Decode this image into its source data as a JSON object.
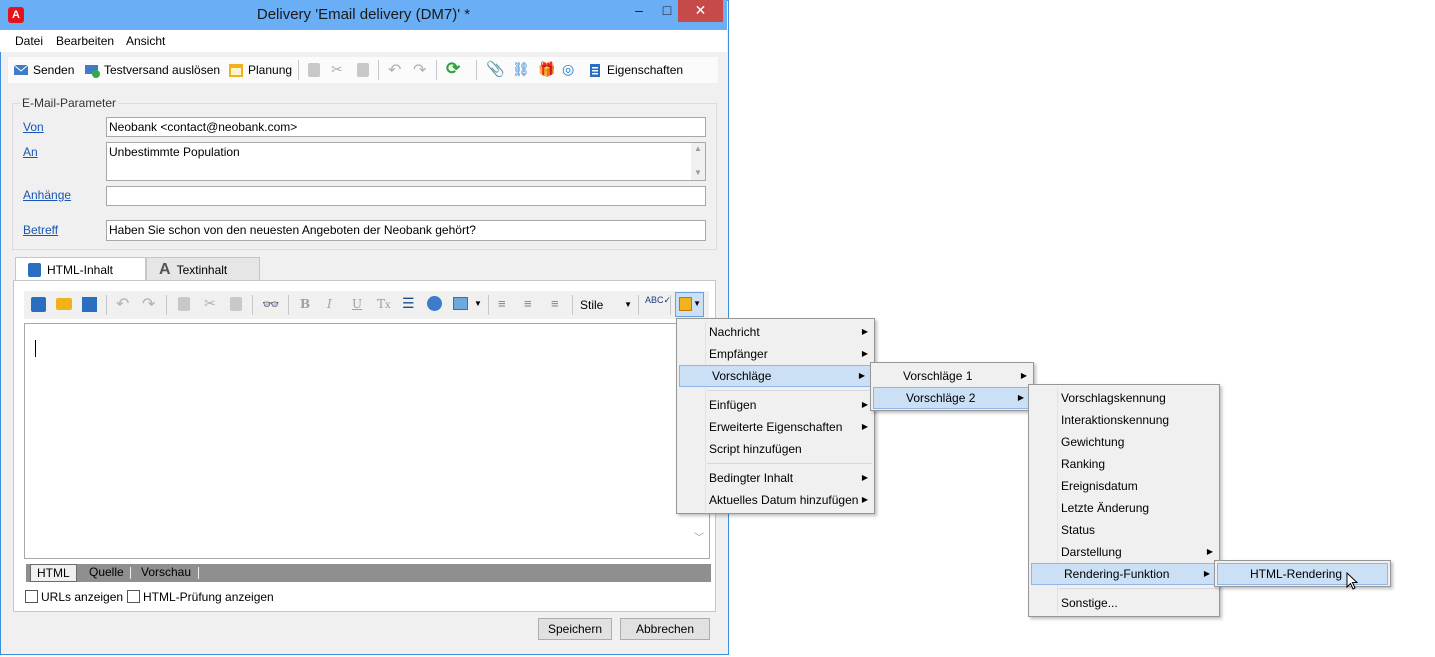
{
  "window": {
    "title": "Delivery 'Email delivery (DM7)' *",
    "app_icon": "Adobe-icon",
    "minimize": "–",
    "maximize": "□",
    "close": "✕"
  },
  "menubar": [
    "Datei",
    "Bearbeiten",
    "Ansicht"
  ],
  "toolbar": {
    "send": "Senden",
    "test_send": "Testversand auslösen",
    "planning": "Planung",
    "properties": "Eigenschaften"
  },
  "params": {
    "group_label": "E-Mail-Parameter",
    "from_label": "Von",
    "from_value": "Neobank <contact@neobank.com>",
    "to_label": "An",
    "to_value": "Unbestimmte Population",
    "attachments_label": "Anhänge",
    "attachments_value": "",
    "subject_label": "Betreff",
    "subject_value": "Haben Sie schon von den neuesten Angeboten der Neobank gehört?"
  },
  "tabs": {
    "html": "HTML-Inhalt",
    "text": "Textinhalt"
  },
  "editor_toolbar": {
    "styles": "Stile"
  },
  "bottom_tabs": [
    "HTML",
    "Quelle",
    "Vorschau"
  ],
  "checkboxes": {
    "urls": "URLs anzeigen",
    "html_check": "HTML-Prüfung anzeigen"
  },
  "buttons": {
    "save": "Speichern",
    "cancel": "Abbrechen"
  },
  "menu1": {
    "items": [
      "Nachricht",
      "Empfänger",
      "Vorschläge",
      "Einfügen",
      "Erweiterte Eigenschaften",
      "Script hinzufügen",
      "Bedingter Inhalt",
      "Aktuelles Datum hinzufügen"
    ],
    "highlighted": "Vorschläge"
  },
  "menu2": {
    "items": [
      "Vorschläge 1",
      "Vorschläge 2"
    ],
    "highlighted": "Vorschläge 2"
  },
  "menu3": {
    "items": [
      "Vorschlagskennung",
      "Interaktionskennung",
      "Gewichtung",
      "Ranking",
      "Ereignisdatum",
      "Letzte Änderung",
      "Status",
      "Darstellung",
      "Rendering-Funktion",
      "Sonstige..."
    ],
    "highlighted": "Rendering-Funktion"
  },
  "menu4": {
    "items": [
      "HTML-Rendering"
    ],
    "highlighted": "HTML-Rendering"
  },
  "colors": {
    "titlebar": "#6aaef5",
    "highlight": "#cbdff5",
    "link": "#1a55b4",
    "close": "#c74a4a"
  }
}
